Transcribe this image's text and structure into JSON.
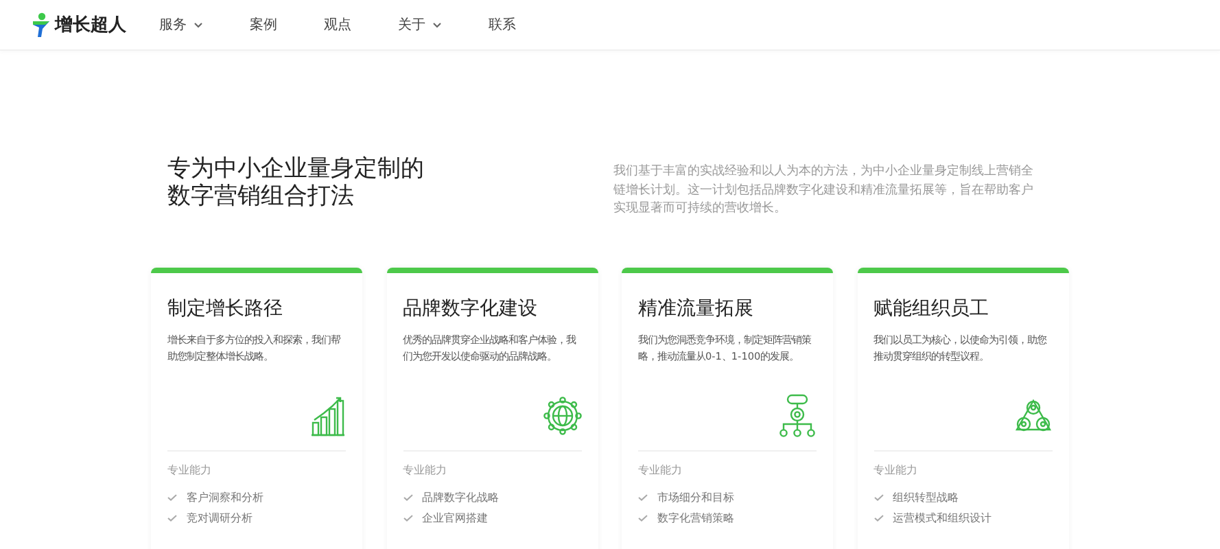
{
  "nav": {
    "logo": "增长超人",
    "items": [
      {
        "label": "服务",
        "dropdown": true
      },
      {
        "label": "案例",
        "dropdown": false
      },
      {
        "label": "观点",
        "dropdown": false
      },
      {
        "label": "关于",
        "dropdown": true
      },
      {
        "label": "联系",
        "dropdown": false
      }
    ]
  },
  "intro": {
    "heading": "专为中小企业量身定制的数字营销组合打法",
    "text": "我们基于丰富的实战经验和以人为本的方法，为中小企业量身定制线上营销全链增长计划。这一计划包括品牌数字化建设和精准流量拓展等，旨在帮助客户实现显著而可持续的营收增长。"
  },
  "cards": [
    {
      "title": "制定增长路径",
      "description": "增长来自于多方位的投入和探索，我们帮助您制定整体增长战略。",
      "kind": "chart",
      "capability_label": "专业能力",
      "capabilities": [
        "客户洞察和分析",
        "竞对调研分析"
      ]
    },
    {
      "title": "品牌数字化建设",
      "description": "优秀的品牌贯穿企业战略和客户体验，我们为您开发以使命驱动的品牌战略。",
      "kind": "globe",
      "capability_label": "专业能力",
      "capabilities": [
        "品牌数字化战略",
        "企业官网搭建"
      ]
    },
    {
      "title": "精准流量拓展",
      "description": "我们为您洞悉竞争环境，制定矩阵营销策略，推动流量从0-1、1-100的发展。",
      "kind": "flow",
      "capability_label": "专业能力",
      "capabilities": [
        "市场细分和目标",
        "数字化营销策略"
      ]
    },
    {
      "title": "赋能组织员工",
      "description": "我们以员工为核心，以使命为引领，助您推动贯穿组织的转型议程。",
      "kind": "team",
      "capability_label": "专业能力",
      "capabilities": [
        "组织转型战略",
        "运营模式和组织设计"
      ]
    }
  ]
}
